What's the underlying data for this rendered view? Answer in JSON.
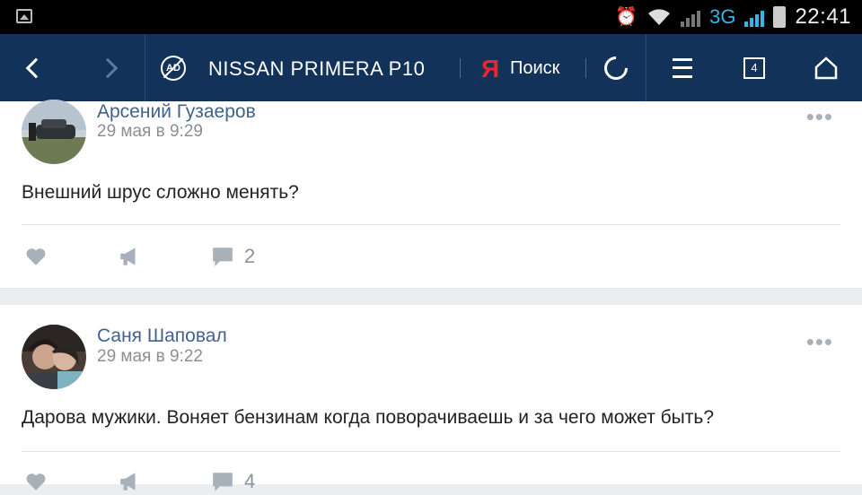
{
  "statusbar": {
    "time": "22:41",
    "network": "3G"
  },
  "toolbar": {
    "title": "NISSAN PRIMERA P10",
    "search_brand": "Я",
    "search_label": "Поиск",
    "tab_count": "4"
  },
  "posts": [
    {
      "author": "Арсений Гузаеров",
      "date": "29 мая в 9:29",
      "text": "Внешний шрус сложно менять?",
      "comments": "2"
    },
    {
      "author": "Саня Шаповал",
      "date": "29 мая в 9:22",
      "text": "Дарова мужики. Воняет бензинам когда поворачиваешь и за чего может быть?",
      "comments": "4"
    }
  ],
  "colors": {
    "toolbar_bg": "#13325a",
    "author_link": "#41628f",
    "yandex_red": "#e8262b",
    "network_blue": "#33b5e5"
  }
}
